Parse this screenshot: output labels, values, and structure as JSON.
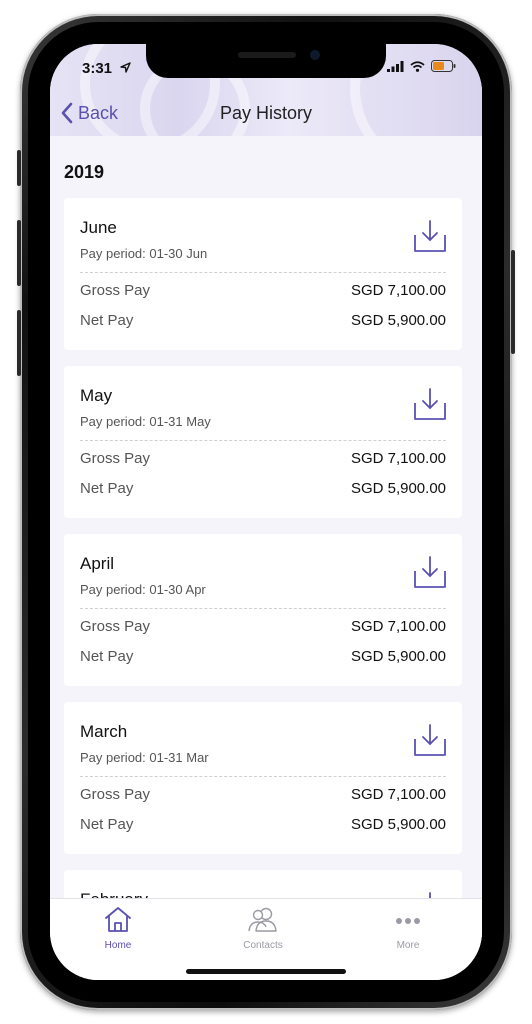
{
  "status_bar": {
    "time": "3:31"
  },
  "nav": {
    "back_label": "Back",
    "title": "Pay History"
  },
  "year": "2019",
  "cards": [
    {
      "month": "June",
      "period": "Pay period: 01-30 Jun",
      "gross_label": "Gross Pay",
      "gross_value": "SGD 7,100.00",
      "net_label": "Net Pay",
      "net_value": "SGD 5,900.00"
    },
    {
      "month": "May",
      "period": "Pay period: 01-31 May",
      "gross_label": "Gross Pay",
      "gross_value": "SGD 7,100.00",
      "net_label": "Net Pay",
      "net_value": "SGD 5,900.00"
    },
    {
      "month": "April",
      "period": "Pay period: 01-30 Apr",
      "gross_label": "Gross Pay",
      "gross_value": "SGD 7,100.00",
      "net_label": "Net Pay",
      "net_value": "SGD 5,900.00"
    },
    {
      "month": "March",
      "period": "Pay period: 01-31 Mar",
      "gross_label": "Gross Pay",
      "gross_value": "SGD 7,100.00",
      "net_label": "Net Pay",
      "net_value": "SGD 5,900.00"
    },
    {
      "month": "February"
    }
  ],
  "tabbar": {
    "items": [
      {
        "label": "Home",
        "icon": "home-icon",
        "active": true
      },
      {
        "label": "Contacts",
        "icon": "contacts-icon",
        "active": false
      },
      {
        "label": "More",
        "icon": "more-icon",
        "active": false
      }
    ]
  },
  "colors": {
    "accent": "#5a50b0",
    "inactive": "#9a9aa4",
    "background": "#f5f4fb",
    "battery": "#e8891c"
  }
}
